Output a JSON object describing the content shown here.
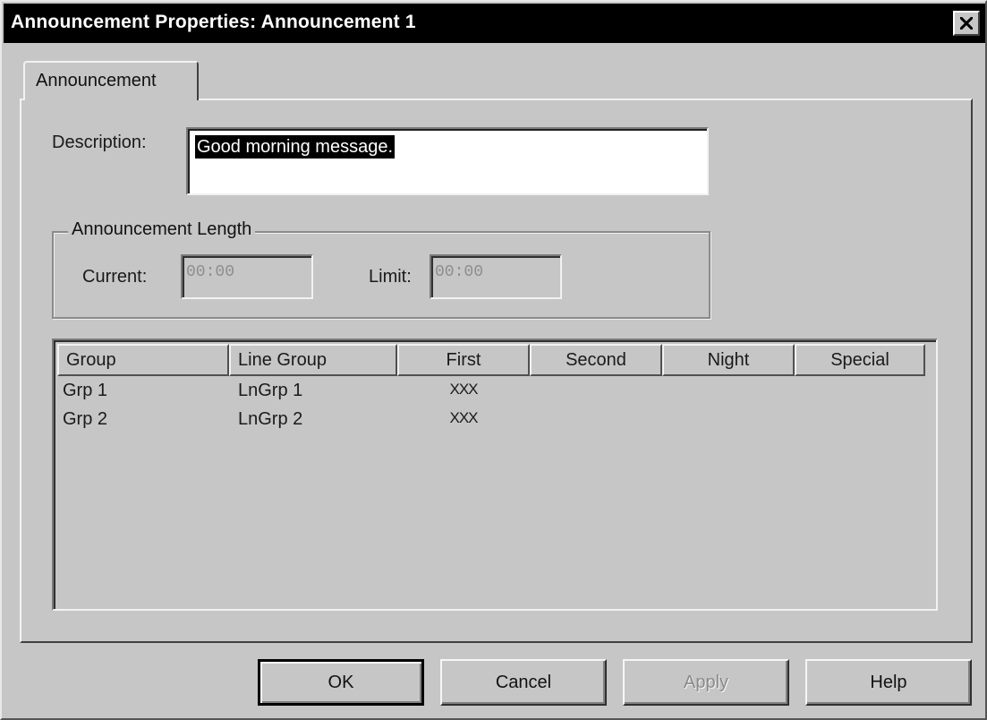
{
  "window": {
    "title": "Announcement Properties: Announcement 1",
    "close_icon": "close-icon"
  },
  "tabs": [
    {
      "label": "Announcement",
      "selected": true
    }
  ],
  "description": {
    "label": "Description:",
    "value": "Good morning message."
  },
  "announcement_length": {
    "title": "Announcement Length",
    "current_label": "Current:",
    "current_value": "00:00",
    "limit_label": "Limit:",
    "limit_value": "00:00"
  },
  "list": {
    "columns": [
      "Group",
      "Line Group",
      "First",
      "Second",
      "Night",
      "Special"
    ],
    "rows": [
      {
        "group": "Grp 1",
        "line_group": "LnGrp 1",
        "first": "XXX",
        "second": "",
        "night": "",
        "special": ""
      },
      {
        "group": "Grp 2",
        "line_group": "LnGrp 2",
        "first": "XXX",
        "second": "",
        "night": "",
        "special": ""
      }
    ]
  },
  "buttons": {
    "ok": "OK",
    "cancel": "Cancel",
    "apply": "Apply",
    "help": "Help"
  },
  "colors": {
    "title_bar": "#000000",
    "face": "#c6c6c6",
    "selection": "#000000"
  }
}
